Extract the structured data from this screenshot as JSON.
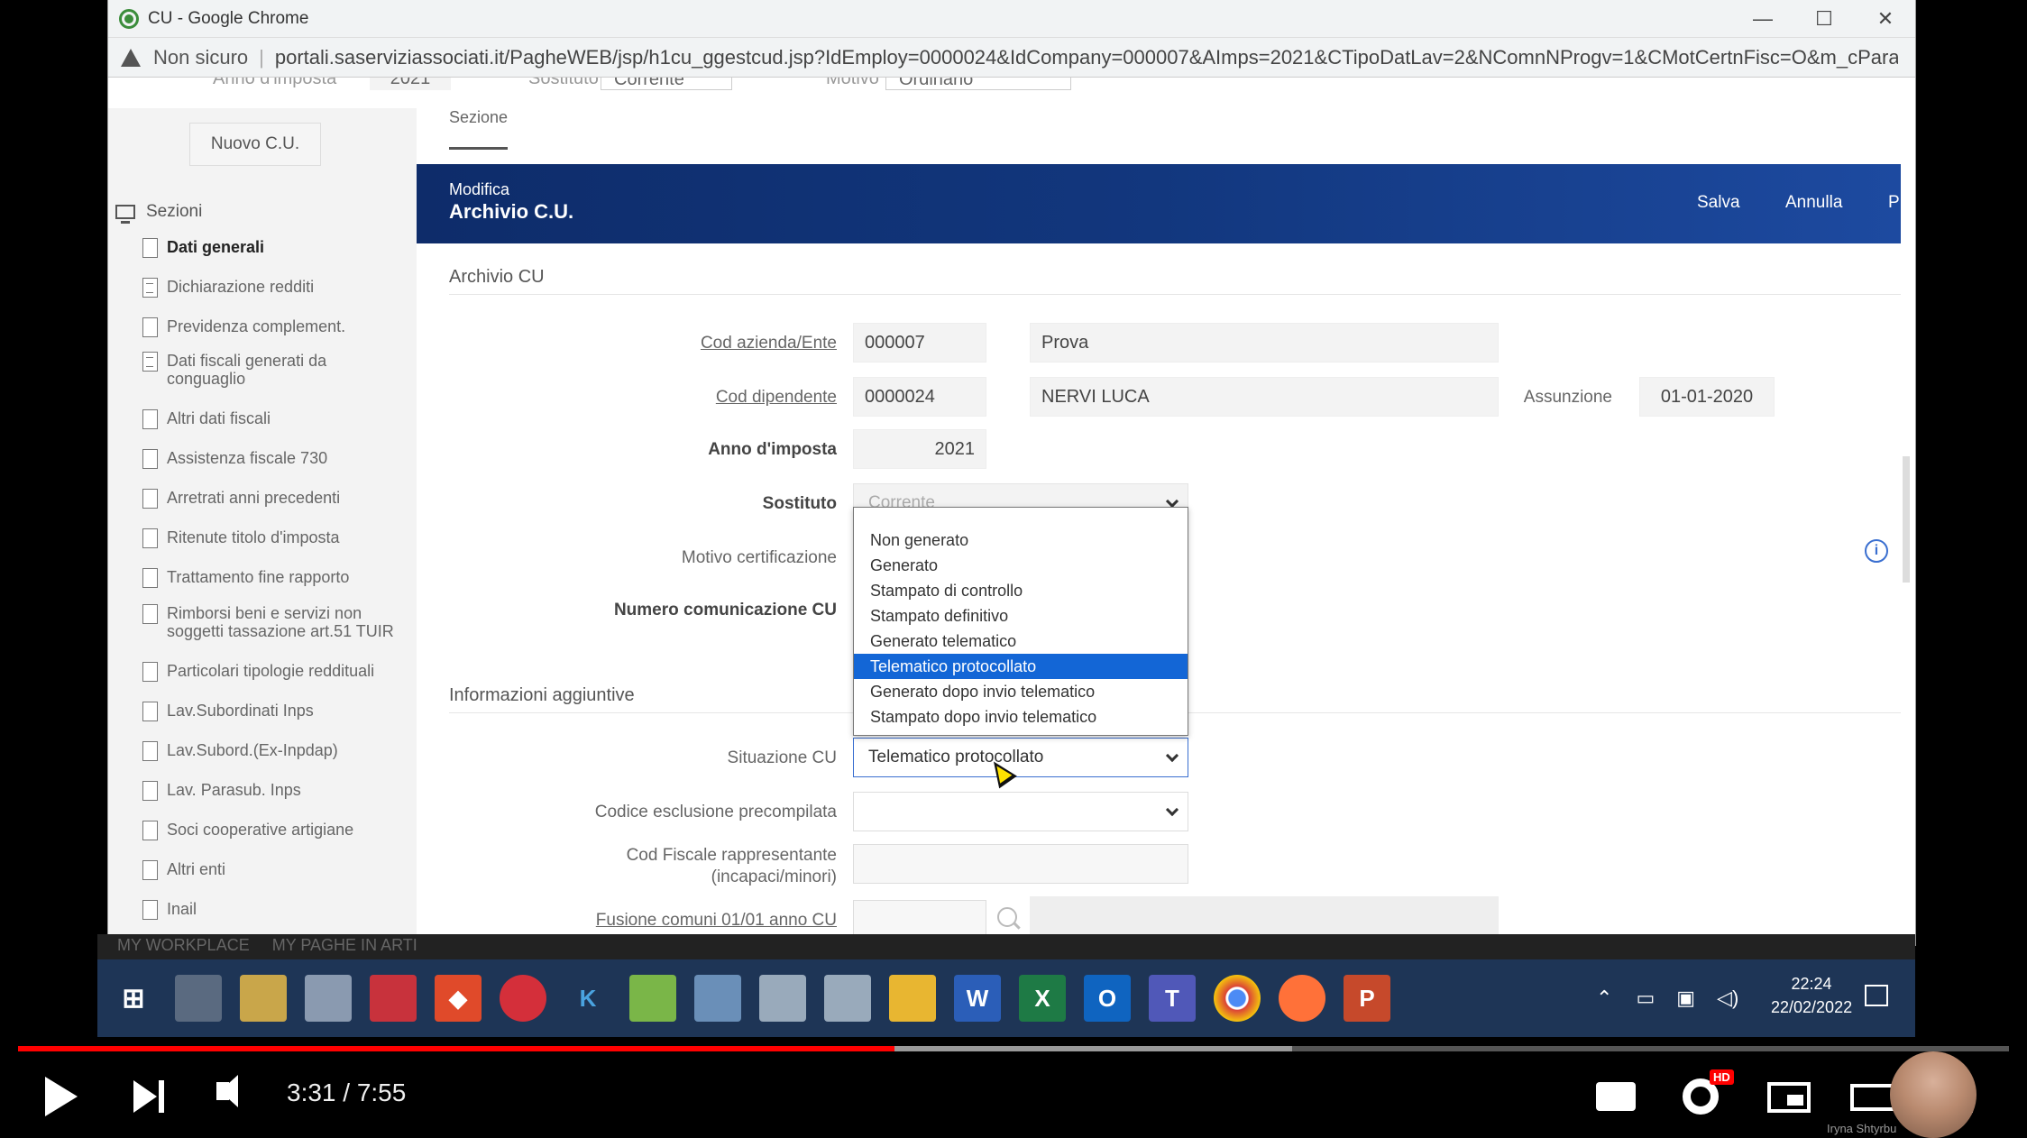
{
  "window": {
    "title": "CU - Google Chrome",
    "security_label": "Non sicuro",
    "url": "portali.saserviziassociati.it/PagheWEB/jsp/h1cu_ggestcud.jsp?IdEmploy=0000024&IdCompany=000007&AImps=2021&CTipoDatLav=2&NComnNProgv=1&CMotCertnFisc=O&m_cParameterSequ..."
  },
  "top_cut": {
    "anno_label": "Anno d'imposta",
    "anno_value": "2021",
    "sostituto_label": "Sostituto",
    "sostituto_value": "Corrente",
    "motivo_label": "Motivo",
    "motivo_value": "Ordinario"
  },
  "sidebar": {
    "new_button": "Nuovo C.U.",
    "heading": "Sezioni",
    "items": [
      {
        "label": "Dati generali"
      },
      {
        "label": "Dichiarazione redditi"
      },
      {
        "label": "Previdenza complement."
      },
      {
        "label": "Dati fiscali generati da conguaglio"
      },
      {
        "label": "Altri dati fiscali"
      },
      {
        "label": "Assistenza fiscale 730"
      },
      {
        "label": "Arretrati anni precedenti"
      },
      {
        "label": "Ritenute titolo d'imposta"
      },
      {
        "label": "Trattamento fine rapporto"
      },
      {
        "label": "Rimborsi beni e servizi non soggetti tassazione art.51 TUIR"
      },
      {
        "label": "Particolari tipologie reddituali"
      },
      {
        "label": "Lav.Subordinati Inps"
      },
      {
        "label": "Lav.Subord.(Ex-Inpdap)"
      },
      {
        "label": "Lav. Parasub. Inps"
      },
      {
        "label": "Soci cooperative artigiane"
      },
      {
        "label": "Altri enti"
      },
      {
        "label": "Inail"
      }
    ]
  },
  "main": {
    "tab": "Sezione",
    "banner": {
      "mode": "Modifica",
      "title": "Archivio C.U.",
      "save": "Salva",
      "cancel": "Annulla",
      "more": "P"
    },
    "section1": "Archivio CU",
    "fields": {
      "cod_azienda_label": "Cod azienda/Ente",
      "cod_azienda_value": "000007",
      "cod_azienda_desc": "Prova",
      "cod_dipendente_label": "Cod dipendente",
      "cod_dipendente_value": "0000024",
      "cod_dipendente_desc": "NERVI LUCA",
      "assunzione_label": "Assunzione",
      "assunzione_value": "01-01-2020",
      "anno_label": "Anno d'imposta",
      "anno_value": "2021",
      "sostituto_label": "Sostituto",
      "sostituto_value": "Corrente",
      "motivo_label": "Motivo certificazione",
      "numero_label": "Numero comunicazione CU"
    },
    "section2": "Informazioni aggiuntive",
    "fields2": {
      "situazione_label": "Situazione CU",
      "situazione_value": "Telematico protocollato",
      "codice_esclusione_label": "Codice esclusione precompilata",
      "cod_fiscale_label_1": "Cod Fiscale rappresentante",
      "cod_fiscale_label_2": "(incapaci/minori)",
      "fusione_label": "Fusione comuni 01/01 anno CU"
    },
    "dropdown_options": [
      {
        "label": "Non generato"
      },
      {
        "label": "Generato"
      },
      {
        "label": "Stampato di controllo"
      },
      {
        "label": "Stampato definitivo"
      },
      {
        "label": "Generato telematico"
      },
      {
        "label": "Telematico protocollato"
      },
      {
        "label": "Generato dopo invio telematico"
      },
      {
        "label": "Stampato dopo invio telematico"
      }
    ],
    "dropdown_selected": "Telematico protocollato"
  },
  "tabstrip": "MY WORKPLACE     MY PAGHE IN ARTI",
  "taskbar": {
    "time": "22:24",
    "date": "22/02/2022"
  },
  "player": {
    "time": "3:31 / 7:55",
    "progress_played": 0.44,
    "progress_buffered": 0.64,
    "hd": "HD",
    "channel": "Iryna Shtyrbu"
  }
}
